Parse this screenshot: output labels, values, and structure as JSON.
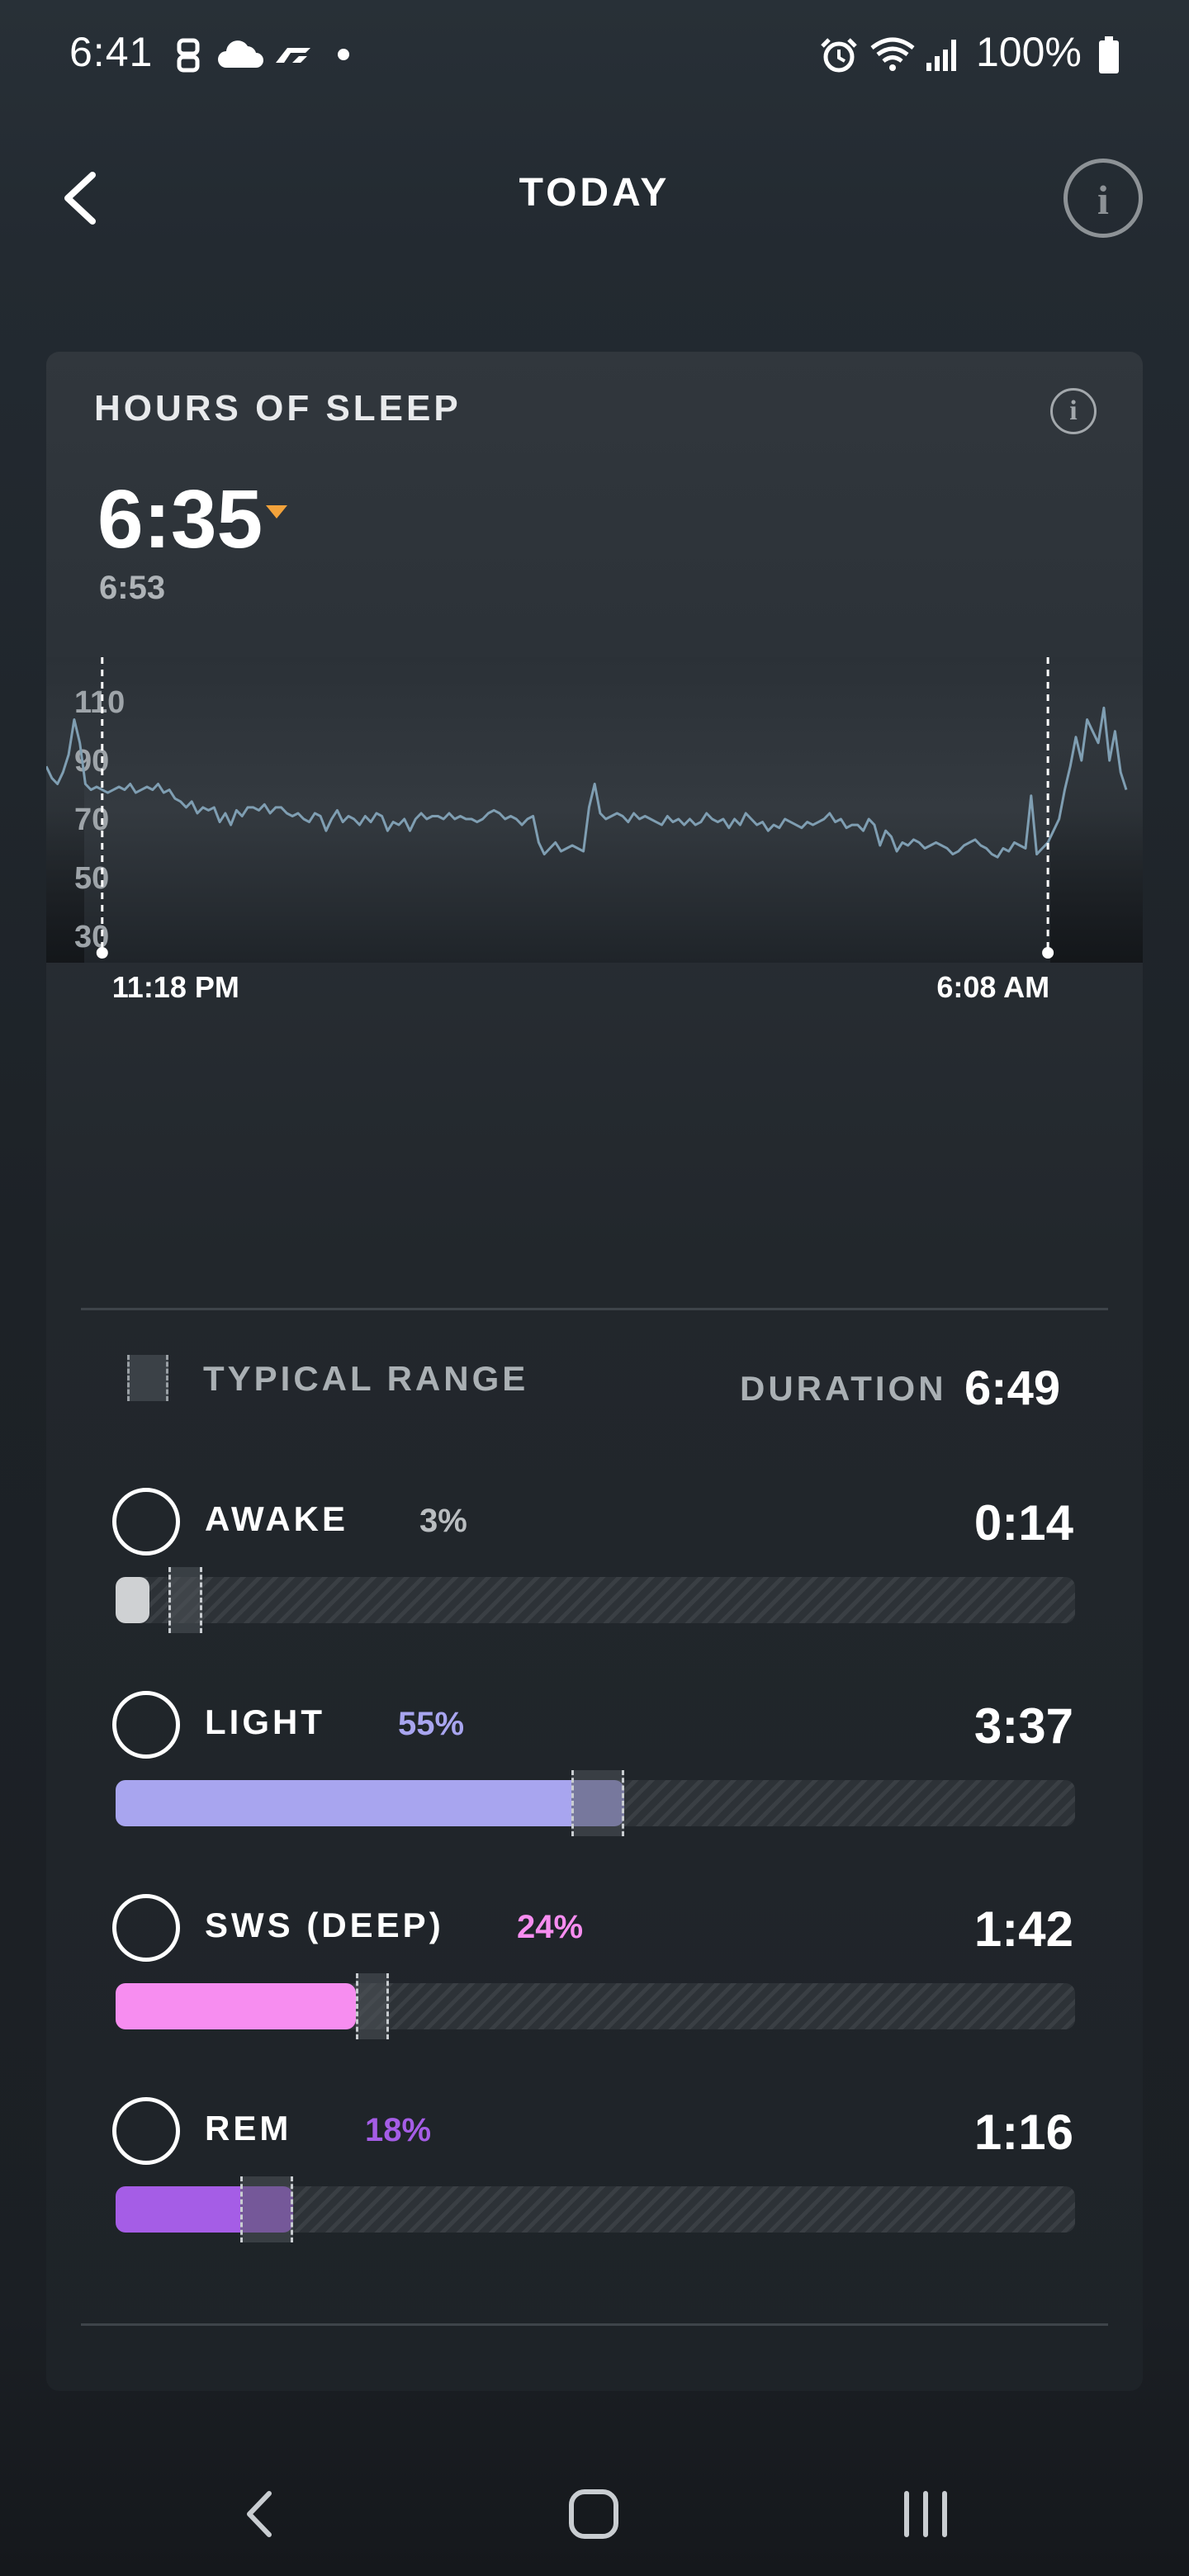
{
  "status_bar": {
    "time": "6:41",
    "battery": "100%",
    "icons": [
      "sim-icon",
      "cloud-icon",
      "f1-icon",
      "dot-icon",
      "alarm-icon",
      "wifi-icon",
      "signal-icon",
      "battery-icon"
    ]
  },
  "header": {
    "title": "TODAY",
    "back_icon": "chevron-left-icon",
    "info_icon": "info-icon"
  },
  "card": {
    "title": "HOURS OF SLEEP",
    "value": "6:35",
    "trend": "down",
    "trend_color": "#f2a23b",
    "previous": "6:53"
  },
  "chart_data": {
    "type": "line",
    "x_start_label": "11:18 PM",
    "x_end_label": "6:08 AM",
    "y_ticks": [
      "110",
      "90",
      "70",
      "50",
      "30"
    ],
    "ylim": [
      28,
      114
    ],
    "grid": false,
    "line_color": "#7f9eb2",
    "series": [
      {
        "values": [
          88,
          84,
          82,
          86,
          92,
          104,
          96,
          82,
          80,
          81,
          80,
          79,
          80,
          81,
          80,
          82,
          79,
          80,
          81,
          80,
          82,
          79,
          80,
          77,
          76,
          74,
          76,
          72,
          74,
          73,
          74,
          69,
          72,
          68,
          73,
          71,
          74,
          74,
          73,
          75,
          72,
          74,
          74,
          72,
          71,
          72,
          70,
          69,
          72,
          71,
          66,
          70,
          73,
          69,
          71,
          70,
          68,
          71,
          69,
          72,
          71,
          66,
          69,
          68,
          70,
          66,
          70,
          72,
          70,
          71,
          71,
          70,
          72,
          70,
          71,
          70,
          70,
          69,
          70,
          72,
          73,
          72,
          70,
          71,
          70,
          68,
          70,
          71,
          62,
          58,
          60,
          62,
          59,
          60,
          61,
          60,
          59,
          74,
          82,
          72,
          70,
          71,
          72,
          71,
          69,
          72,
          70,
          71,
          70,
          69,
          68,
          71,
          69,
          70,
          68,
          70,
          68,
          69,
          72,
          70,
          69,
          70,
          67,
          70,
          68,
          72,
          70,
          68,
          69,
          66,
          68,
          67,
          70,
          69,
          68,
          67,
          69,
          68,
          69,
          70,
          72,
          69,
          70,
          67,
          68,
          68,
          66,
          70,
          68,
          61,
          66,
          64,
          59,
          62,
          61,
          63,
          62,
          60,
          61,
          62,
          61,
          60,
          58,
          59,
          61,
          62,
          63,
          61,
          60,
          58,
          57,
          60,
          59,
          62,
          61,
          60,
          78,
          58,
          60,
          62,
          66,
          70,
          80,
          88,
          98,
          90,
          104,
          100,
          96,
          108,
          90,
          100,
          86,
          80
        ],
        "markers_at_index": [
          10,
          179
        ]
      }
    ],
    "annotations": [
      "11:18 PM",
      "6:08 AM"
    ]
  },
  "summary": {
    "legend_label": "TYPICAL RANGE",
    "duration_label": "DURATION",
    "duration_value": "6:49"
  },
  "stages": [
    {
      "name": "AWAKE",
      "pct_text": "3%",
      "time": "0:14",
      "fraction": 0.035,
      "range": [
        0.055,
        0.09
      ],
      "fill_color": "#cfd1d3",
      "pct_color": "#b9bdc0"
    },
    {
      "name": "LIGHT",
      "pct_text": "55%",
      "time": "3:37",
      "fraction": 0.53,
      "range": [
        0.475,
        0.53
      ],
      "fill_color": "#a8a5ef",
      "pct_color": "#a8a5ef"
    },
    {
      "name": "SWS (DEEP)",
      "pct_text": "24%",
      "time": "1:42",
      "fraction": 0.25,
      "range": [
        0.25,
        0.285
      ],
      "fill_color": "#f78df0",
      "pct_color": "#f78df0"
    },
    {
      "name": "REM",
      "pct_text": "18%",
      "time": "1:16",
      "fraction": 0.185,
      "range": [
        0.13,
        0.185
      ],
      "fill_color": "#a55de6",
      "pct_color": "#a55de6"
    }
  ],
  "nav_bar": {
    "icons": [
      "nav-back-icon",
      "nav-home-icon",
      "nav-recents-icon"
    ]
  }
}
